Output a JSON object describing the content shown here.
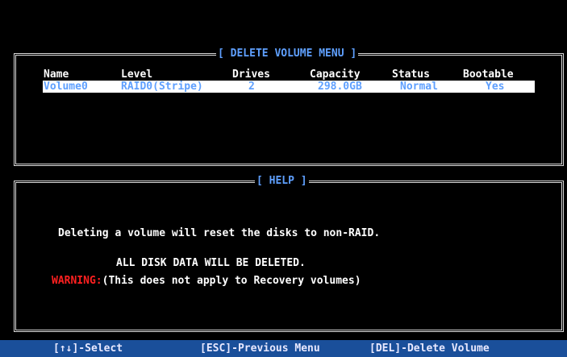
{
  "volume_menu": {
    "title": "[ DELETE VOLUME MENU ]",
    "columns": [
      "Name",
      "Level",
      "Drives",
      "Capacity",
      "Status",
      "Bootable"
    ],
    "volumes": [
      {
        "name": "Volume0",
        "level": "RAID0(Stripe)",
        "drives": "2",
        "capacity": "298.0GB",
        "status": "Normal",
        "bootable": "Yes"
      }
    ]
  },
  "help": {
    "title": "[ HELP ]",
    "line1": "Deleting a volume will reset the disks to non-RAID.",
    "line2": "ALL DISK DATA WILL BE DELETED.",
    "warning_label": "WARNING:",
    "warning_text": "(This does not apply to Recovery volumes)"
  },
  "footer": {
    "select": "[↑↓]-Select",
    "previous": "[ESC]-Previous Menu",
    "delete": "[DEL]-Delete Volume"
  },
  "colors": {
    "title": "#5fa0ff",
    "highlight_bg": "#ffffff",
    "warning": "#ff2020",
    "footer_bg": "#1a4f9a"
  }
}
